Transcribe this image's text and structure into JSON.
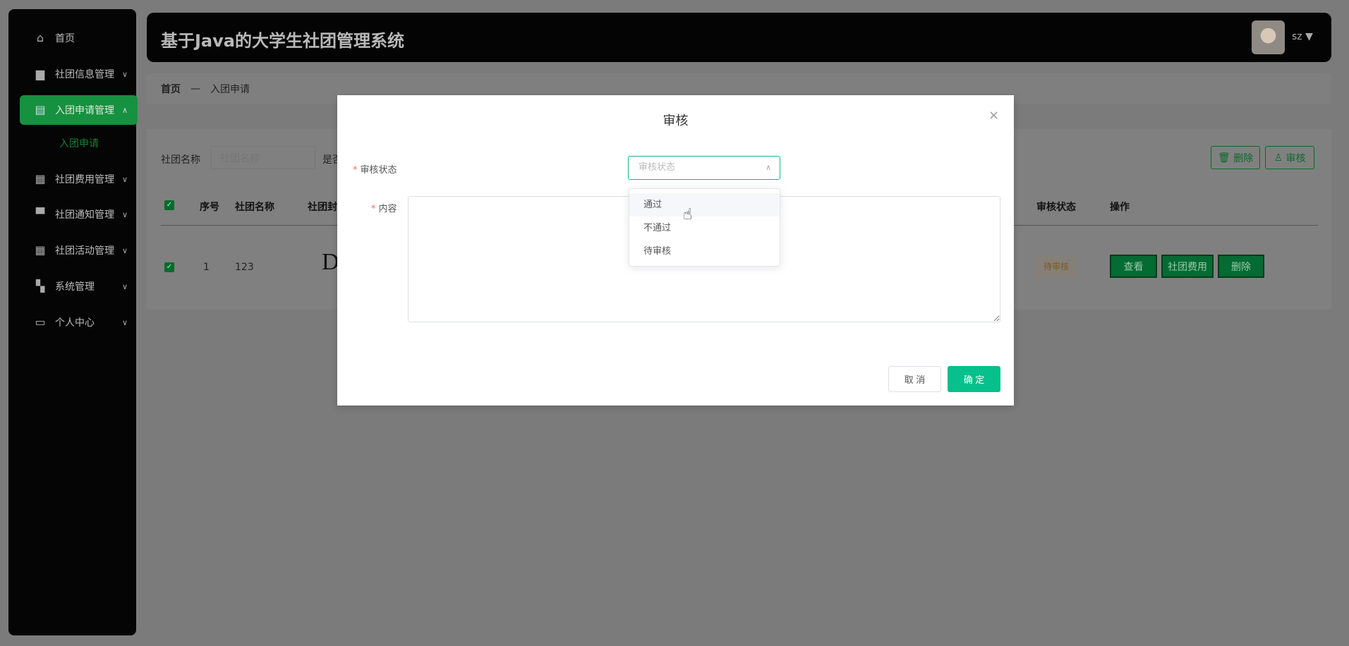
{
  "app": {
    "title": "基于Java的大学生社团管理系统",
    "user": "sz"
  },
  "sidebar": {
    "items": [
      {
        "label": "首页",
        "icon": "home-icon"
      },
      {
        "label": "社团信息管理",
        "icon": "briefcase-icon"
      },
      {
        "label": "入团申请管理",
        "icon": "clipboard-icon",
        "active": true
      },
      {
        "label": "社团费用管理",
        "icon": "grid-icon"
      },
      {
        "label": "社团通知管理",
        "icon": "notice-icon"
      },
      {
        "label": "社团活动管理",
        "icon": "grid-icon"
      },
      {
        "label": "系统管理",
        "icon": "ticket-icon"
      },
      {
        "label": "个人中心",
        "icon": "card-icon"
      }
    ],
    "sub_item": "入团申请"
  },
  "breadcrumb": {
    "home": "首页",
    "sep": "—",
    "current": "入团申请"
  },
  "filter": {
    "label": "社团名称",
    "placeholder": "社团名称",
    "label2": "是否"
  },
  "toolbar": {
    "delete": "删除",
    "review": "审核"
  },
  "table": {
    "headers": [
      "序号",
      "社团名称",
      "社团封",
      "审核状态",
      "操作"
    ],
    "rows": [
      {
        "index": "1",
        "name": "123",
        "cover": "D",
        "status": "待审核",
        "actions": [
          "查看",
          "社团费用",
          "删除"
        ]
      }
    ]
  },
  "dialog": {
    "title": "审核",
    "status_label": "审核状态",
    "status_placeholder": "审核状态",
    "options": [
      "通过",
      "不通过",
      "待审核"
    ],
    "content_label": "内容",
    "cancel": "取 消",
    "confirm": "确 定"
  },
  "colors": {
    "accent": "#07c08b",
    "sidebar_active": "#16913f"
  }
}
